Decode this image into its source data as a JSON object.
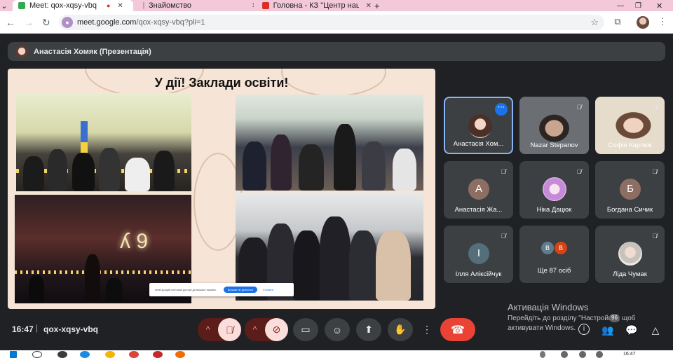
{
  "browser": {
    "tabs": [
      {
        "label": "Meet: qox-xqsy-vbq",
        "active": true
      },
      {
        "label": "Знайомство",
        "active": false
      },
      {
        "label": "Головна - КЗ \"Центр націона...",
        "active": false
      }
    ],
    "new_tab": "+",
    "url_host": "meet.google.com",
    "url_path": "/qox-xqsy-vbq?pli=1"
  },
  "presenter_bar": {
    "label": "Анастасія Хомяк (Презентація)"
  },
  "slide": {
    "title": "У дії! Заклади освіти!",
    "notice": {
      "text": "meet.google.com має доступ до вашого екрана.",
      "button": "Більше не ділитися",
      "link": "Сховати"
    }
  },
  "participants": [
    {
      "name": "Анастасія Хом...",
      "type": "avatar-img",
      "speaking": true
    },
    {
      "name": "Nazar Stepanov",
      "type": "camera"
    },
    {
      "name": "Софія Карпюк",
      "type": "camera"
    },
    {
      "name": "Анастасія Жа...",
      "type": "letter",
      "letter": "А",
      "color": "#8d6e63"
    },
    {
      "name": "Ніка Дацюк",
      "type": "avatar-img"
    },
    {
      "name": "Богдана Сичик",
      "type": "letter",
      "letter": "Б",
      "color": "#8d6e63"
    },
    {
      "name": "Ілля Аліксійчук",
      "type": "letter",
      "letter": "І",
      "color": "#546e7a"
    },
    {
      "name": "Ще 87 осіб",
      "type": "group",
      "letters": [
        "В",
        "В"
      ]
    },
    {
      "name": "Ліда Чумак",
      "type": "avatar-img"
    }
  ],
  "watermark": {
    "line1": "Активація Windows",
    "line2": "Перейдіть до розділу \"Настройки\", щоб",
    "line3": "активувати Windows."
  },
  "meeting": {
    "time": "16:47",
    "separator": "|",
    "code": "qox-xqsy-vbq",
    "people_count": "96"
  },
  "taskbar": {
    "time": "16:47"
  },
  "colors": {
    "background": "#202124",
    "tile": "#3c4043",
    "accent": "#8ab4f8",
    "hangup": "#ea4335",
    "muted_btn": "#f9dedc"
  }
}
